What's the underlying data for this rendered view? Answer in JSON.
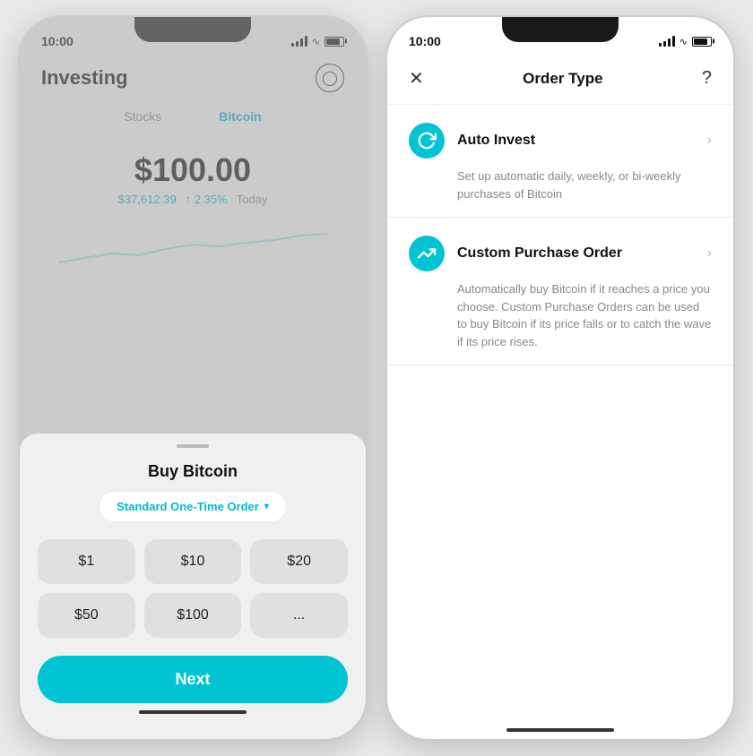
{
  "left_phone": {
    "status_time": "10:00",
    "header": {
      "title": "Investing",
      "avatar_icon": "👤"
    },
    "tabs": [
      {
        "label": "Stocks",
        "active": false
      },
      {
        "label": "Bitcoin",
        "active": true
      }
    ],
    "price": {
      "main": "$100.00",
      "btc": "$37,612.39",
      "change": "↑ 2.35%",
      "period": "Today"
    },
    "sheet": {
      "title": "Buy Bitcoin",
      "order_type": "Standard One-Time Order",
      "chevron": "▾",
      "amounts": [
        "$1",
        "$10",
        "$20",
        "$50",
        "$100",
        "..."
      ],
      "next_btn": "Next"
    }
  },
  "right_phone": {
    "status_time": "10:00",
    "header": {
      "close": "✕",
      "title": "Order Type",
      "help": "?"
    },
    "options": [
      {
        "icon": "↺",
        "name": "Auto Invest",
        "desc": "Set up automatic daily, weekly, or bi-weekly purchases of Bitcoin"
      },
      {
        "icon": "⤢",
        "name": "Custom Purchase Order",
        "desc": "Automatically buy Bitcoin if it reaches a price you choose. Custom Purchase Orders can be used to buy Bitcoin if its price falls or to catch the wave if its price rises."
      }
    ]
  }
}
